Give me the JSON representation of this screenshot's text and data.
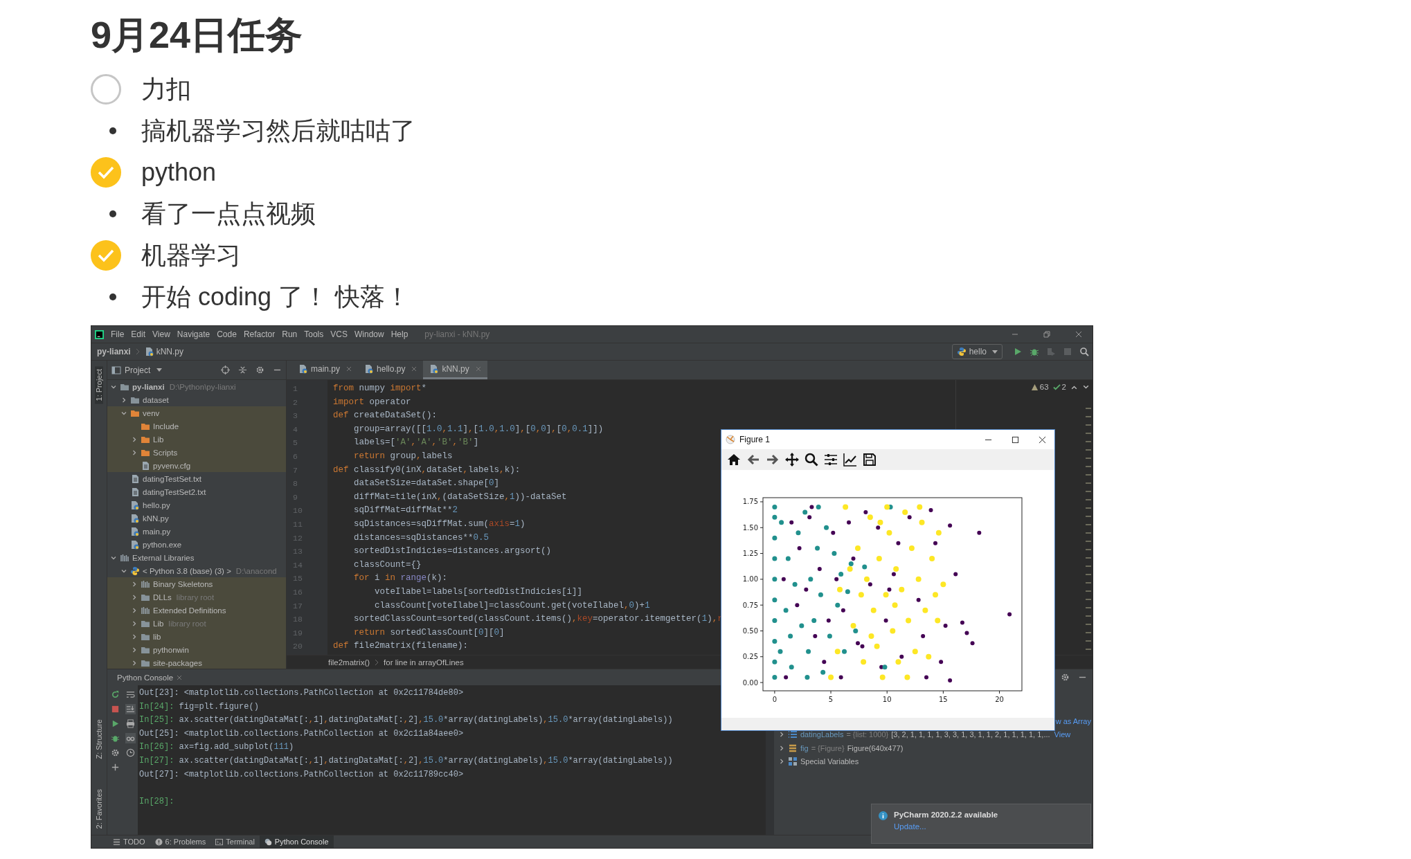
{
  "page_title": "9月24日任务",
  "tasks": [
    {
      "kind": "todo",
      "text": "力扣",
      "checked": false
    },
    {
      "kind": "bullet",
      "text": "搞机器学习然后就咕咕了"
    },
    {
      "kind": "todo",
      "text": "python",
      "checked": true
    },
    {
      "kind": "bullet",
      "text": "看了一点点视频"
    },
    {
      "kind": "todo",
      "text": "机器学习",
      "checked": true
    },
    {
      "kind": "bullet",
      "text": "开始 coding 了！ 快落！"
    }
  ],
  "ide": {
    "menu": [
      "File",
      "Edit",
      "View",
      "Navigate",
      "Code",
      "Refactor",
      "Run",
      "Tools",
      "VCS",
      "Window",
      "Help"
    ],
    "window_title": "py-lianxi - kNN.py",
    "breadcrumb": [
      "py-lianxi",
      "kNN.py"
    ],
    "run_config": "hello",
    "side_labels": [
      {
        "label": "1: Project",
        "selected": true
      },
      {
        "label": "Z: Structure",
        "selected": false
      },
      {
        "label": "2: Favorites",
        "selected": false
      }
    ],
    "project_panel": {
      "title": "Project",
      "tree": [
        {
          "label": "py-lianxi",
          "kind": "project",
          "hint": "D:\\Python\\py-lianxi",
          "expanded": true,
          "highlighted": false,
          "children": [
            {
              "label": "dataset",
              "kind": "folder",
              "expanded": false,
              "highlighted": false
            },
            {
              "label": "venv",
              "kind": "excluded-folder",
              "expanded": true,
              "highlighted": true,
              "children": [
                {
                  "label": "Include",
                  "kind": "excluded-folder",
                  "highlighted": true
                },
                {
                  "label": "Lib",
                  "kind": "excluded-folder",
                  "expanded": false,
                  "highlighted": true
                },
                {
                  "label": "Scripts",
                  "kind": "excluded-folder",
                  "expanded": false,
                  "highlighted": true
                },
                {
                  "label": "pyvenv.cfg",
                  "kind": "text-file",
                  "highlighted": true
                }
              ]
            },
            {
              "label": "datingTestSet.txt",
              "kind": "text-file",
              "highlighted": false
            },
            {
              "label": "datingTestSet2.txt",
              "kind": "text-file",
              "highlighted": false
            },
            {
              "label": "hello.py",
              "kind": "py-file",
              "highlighted": false
            },
            {
              "label": "kNN.py",
              "kind": "py-file",
              "highlighted": false
            },
            {
              "label": "main.py",
              "kind": "py-file",
              "highlighted": false
            },
            {
              "label": "python.exe",
              "kind": "exe-file",
              "highlighted": false
            }
          ]
        },
        {
          "label": "External Libraries",
          "kind": "library",
          "expanded": true,
          "highlighted": false,
          "children": [
            {
              "label": "< Python 3.8 (base) (3) >",
              "kind": "python-sdk",
              "hint": "D:\\anacond",
              "expanded": true,
              "highlighted": false,
              "children": [
                {
                  "label": "Binary Skeletons",
                  "kind": "library",
                  "expanded": false,
                  "highlighted": true
                },
                {
                  "label": "DLLs",
                  "kind": "folder",
                  "hint": "library root",
                  "expanded": false,
                  "highlighted": true
                },
                {
                  "label": "Extended Definitions",
                  "kind": "library",
                  "expanded": false,
                  "highlighted": true
                },
                {
                  "label": "Lib",
                  "kind": "folder",
                  "hint": "library root",
                  "expanded": false,
                  "highlighted": true
                },
                {
                  "label": "lib",
                  "kind": "folder",
                  "expanded": false,
                  "highlighted": true
                },
                {
                  "label": "pythonwin",
                  "kind": "folder",
                  "expanded": false,
                  "highlighted": true
                },
                {
                  "label": "site-packages",
                  "kind": "folder",
                  "expanded": false,
                  "highlighted": true
                }
              ]
            }
          ]
        }
      ]
    },
    "editor_tabs": [
      {
        "label": "main.py",
        "selected": false
      },
      {
        "label": "hello.py",
        "selected": false
      },
      {
        "label": "kNN.py",
        "selected": true
      }
    ],
    "inspections": {
      "warnings": "63",
      "typos": "2"
    },
    "code_lines": [
      {
        "n": "1",
        "t": [
          {
            "kind": "kw",
            "text": "from"
          },
          {
            "kind": "tx",
            "text": " numpy "
          },
          {
            "kind": "kw",
            "text": "import"
          },
          {
            "kind": "tx",
            "text": "*"
          }
        ]
      },
      {
        "n": "2",
        "t": [
          {
            "kind": "kw",
            "text": "import"
          },
          {
            "kind": "tx",
            "text": " operator"
          }
        ]
      },
      {
        "n": "3",
        "t": [
          {
            "kind": "kw",
            "text": "def"
          },
          {
            "kind": "tx",
            "text": " createDataSet():"
          }
        ]
      },
      {
        "n": "4",
        "t": [
          {
            "kind": "tx",
            "text": "    group=array([["
          },
          {
            "kind": "num",
            "text": "1.0"
          },
          {
            "kind": "tx",
            "text": ","
          },
          {
            "kind": "num",
            "text": "1.1"
          },
          {
            "kind": "tx",
            "text": "],["
          },
          {
            "kind": "num",
            "text": "1.0"
          },
          {
            "kind": "tx",
            "text": ","
          },
          {
            "kind": "num",
            "text": "1.0"
          },
          {
            "kind": "tx",
            "text": "],["
          },
          {
            "kind": "num",
            "text": "0"
          },
          {
            "kind": "tx",
            "text": ","
          },
          {
            "kind": "num",
            "text": "0"
          },
          {
            "kind": "tx",
            "text": "],["
          },
          {
            "kind": "num",
            "text": "0"
          },
          {
            "kind": "tx",
            "text": ","
          },
          {
            "kind": "num",
            "text": "0.1"
          },
          {
            "kind": "tx",
            "text": "]])"
          }
        ]
      },
      {
        "n": "5",
        "t": [
          {
            "kind": "tx",
            "text": "    labels=["
          },
          {
            "kind": "str",
            "text": "'A'"
          },
          {
            "kind": "tx",
            "text": ","
          },
          {
            "kind": "str",
            "text": "'A'"
          },
          {
            "kind": "tx",
            "text": ","
          },
          {
            "kind": "str",
            "text": "'B'"
          },
          {
            "kind": "tx",
            "text": ","
          },
          {
            "kind": "str",
            "text": "'B'"
          },
          {
            "kind": "tx",
            "text": "]"
          }
        ]
      },
      {
        "n": "6",
        "t": [
          {
            "kind": "kw",
            "text": "    return"
          },
          {
            "kind": "tx",
            "text": " group,labels"
          }
        ]
      },
      {
        "n": "7",
        "t": [
          {
            "kind": "kw",
            "text": "def"
          },
          {
            "kind": "tx",
            "text": " classify0(inX,dataSet,labels,k):"
          }
        ]
      },
      {
        "n": "8",
        "t": [
          {
            "kind": "tx",
            "text": "    dataSetSize=dataSet.shape["
          },
          {
            "kind": "num",
            "text": "0"
          },
          {
            "kind": "tx",
            "text": "]"
          }
        ]
      },
      {
        "n": "9",
        "t": [
          {
            "kind": "tx",
            "text": "    diffMat=tile(inX,(dataSetSize,"
          },
          {
            "kind": "num",
            "text": "1"
          },
          {
            "kind": "tx",
            "text": "))-dataSet"
          }
        ]
      },
      {
        "n": "10",
        "t": [
          {
            "kind": "tx",
            "text": "    sqDiffMat=diffMat**"
          },
          {
            "kind": "num",
            "text": "2"
          }
        ]
      },
      {
        "n": "11",
        "t": [
          {
            "kind": "tx",
            "text": "    sqDistances=sqDiffMat.sum("
          },
          {
            "kind": "arg",
            "text": "axis"
          },
          {
            "kind": "tx",
            "text": "="
          },
          {
            "kind": "num",
            "text": "1"
          },
          {
            "kind": "tx",
            "text": ")"
          }
        ]
      },
      {
        "n": "12",
        "t": [
          {
            "kind": "tx",
            "text": "    distances=sqDistances**"
          },
          {
            "kind": "num",
            "text": "0.5"
          }
        ]
      },
      {
        "n": "13",
        "t": [
          {
            "kind": "tx",
            "text": "    sortedDistIndicies=distances.argsort()"
          }
        ]
      },
      {
        "n": "14",
        "t": [
          {
            "kind": "tx",
            "text": "    classCount={}"
          }
        ]
      },
      {
        "n": "15",
        "t": [
          {
            "kind": "kw",
            "text": "    for"
          },
          {
            "kind": "tx",
            "text": " i "
          },
          {
            "kind": "kw",
            "text": "in"
          },
          {
            "kind": "bi",
            "text": " range"
          },
          {
            "kind": "tx",
            "text": "(k):"
          }
        ]
      },
      {
        "n": "16",
        "t": [
          {
            "kind": "tx",
            "text": "        voteIlabel=labels[sortedDistIndicies[i]]"
          }
        ]
      },
      {
        "n": "17",
        "t": [
          {
            "kind": "tx",
            "text": "        classCount[voteIlabel]=classCount.get(voteIlabel,"
          },
          {
            "kind": "num",
            "text": "0"
          },
          {
            "kind": "tx",
            "text": ")+"
          },
          {
            "kind": "num",
            "text": "1"
          }
        ]
      },
      {
        "n": "18",
        "t": [
          {
            "kind": "tx",
            "text": "    sortedClassCount=sorted(classCount.items(),"
          },
          {
            "kind": "arg",
            "text": "key"
          },
          {
            "kind": "tx",
            "text": "=operator.itemgetter("
          },
          {
            "kind": "num",
            "text": "1"
          },
          {
            "kind": "tx",
            "text": "),"
          },
          {
            "kind": "arg",
            "text": "r"
          }
        ]
      },
      {
        "n": "19",
        "t": [
          {
            "kind": "kw",
            "text": "    return"
          },
          {
            "kind": "tx",
            "text": " sortedClassCount["
          },
          {
            "kind": "num",
            "text": "0"
          },
          {
            "kind": "tx",
            "text": "]["
          },
          {
            "kind": "num",
            "text": "0"
          },
          {
            "kind": "tx",
            "text": "]"
          }
        ]
      },
      {
        "n": "20",
        "t": [
          {
            "kind": "kw",
            "text": "def"
          },
          {
            "kind": "tx",
            "text": " file2matrix(filename):"
          }
        ]
      }
    ],
    "code_breadcrumb": [
      "file2matrix()",
      "for line in arrayOfLines"
    ],
    "console": {
      "title": "Python Console",
      "lines": [
        {
          "kind": "out",
          "text": "Out[23]: <matplotlib.collections.PathCollection at 0x2c11784de80>"
        },
        {
          "kind": "in",
          "prompt": "In[24]:",
          "t": [
            {
              "kind": "tx",
              "text": " fig=plt.figure()"
            }
          ]
        },
        {
          "kind": "in",
          "prompt": "In[25]:",
          "t": [
            {
              "kind": "tx",
              "text": " ax.scatter(datingDataMat[:,1],datingDataMat[:,2],"
            },
            {
              "kind": "num",
              "text": "15.0"
            },
            {
              "kind": "tx",
              "text": "*array(datingLabels),"
            },
            {
              "kind": "num",
              "text": "15.0"
            },
            {
              "kind": "tx",
              "text": "*array(datingLabels))"
            }
          ]
        },
        {
          "kind": "out",
          "text": "Out[25]: <matplotlib.collections.PathCollection at 0x2c11a84aee0>"
        },
        {
          "kind": "in",
          "prompt": "In[26]:",
          "t": [
            {
              "kind": "tx",
              "text": " ax=fig.add_subplot("
            },
            {
              "kind": "num",
              "text": "111"
            },
            {
              "kind": "tx",
              "text": ")"
            }
          ]
        },
        {
          "kind": "in",
          "prompt": "In[27]:",
          "t": [
            {
              "kind": "tx",
              "text": " ax.scatter(datingDataMat[:,1],datingDataMat[:,2],"
            },
            {
              "kind": "num",
              "text": "15.0"
            },
            {
              "kind": "tx",
              "text": "*array(datingLabels),"
            },
            {
              "kind": "num",
              "text": "15.0"
            },
            {
              "kind": "tx",
              "text": "*array(datingLabels))"
            }
          ]
        },
        {
          "kind": "out",
          "text": "Out[27]: <matplotlib.collections.PathCollection at 0x2c11789cc40>"
        },
        {
          "kind": "blank"
        },
        {
          "kind": "in",
          "prompt": "In[28]:"
        }
      ]
    },
    "variables": {
      "covered_link": "w as Array",
      "rows": [
        {
          "kind": "list",
          "name": "datingLabels",
          "type": "= {list: 1000}",
          "value": "[3, 2, 1, 1, 1, 1, 3, 3, 1, 3, 1, 1, 2, 1, 1, 1, 1, 1,...",
          "link": "View"
        },
        {
          "kind": "object",
          "name": "fig",
          "type": "= {Figure}",
          "value": "Figure(640x477)"
        },
        {
          "kind": "special",
          "name": "Special Variables"
        }
      ]
    },
    "notification": {
      "title": "PyCharm 2020.2.2 available",
      "link": "Update..."
    },
    "tool_tabs": [
      {
        "label": "TODO",
        "kind": "todo",
        "selected": false
      },
      {
        "label": "6: Problems",
        "kind": "problems",
        "selected": false
      },
      {
        "label": "Terminal",
        "kind": "terminal",
        "selected": false
      },
      {
        "label": "Python Console",
        "kind": "python",
        "selected": true
      }
    ],
    "figure": {
      "title": "Figure 1",
      "chart_data": {
        "type": "scatter",
        "xlim": [
          -1.04,
          22
        ],
        "ylim": [
          -0.08,
          1.79
        ],
        "xticks": [
          0,
          5,
          10,
          15,
          20
        ],
        "yticks": [
          {
            "value": 0,
            "label": "0.00"
          },
          {
            "value": 0.25,
            "label": "0.25"
          },
          {
            "value": 0.5,
            "label": "0.50"
          },
          {
            "value": 0.75,
            "label": "0.75"
          },
          {
            "value": 1,
            "label": "1.00"
          },
          {
            "value": 1.25,
            "label": "1.25"
          },
          {
            "value": 1.5,
            "label": "1.50"
          },
          {
            "value": 1.75,
            "label": "1.75"
          }
        ],
        "series": [
          {
            "color": "#440154",
            "x": [
              1.5,
              2.2,
              3.1,
              4.0,
              2.8,
              3.6,
              4.4,
              5.2,
              6.1,
              7.0,
              7.8,
              8.5,
              9.2,
              9.9,
              10.6,
              11.3,
              12.0,
              12.8,
              13.5,
              13.9,
              14.3,
              15.2,
              15.6,
              16.1,
              16.7,
              17.1,
              17.6,
              18.2,
              20.9,
              1.0,
              2.0,
              3.3,
              4.8,
              5.9,
              6.6,
              8.1,
              9.5,
              11.0,
              13.2,
              14.8,
              15.6,
              0.8,
              5.5,
              7.4,
              10.2
            ],
            "values": [
              1.55,
              1.3,
              1.6,
              1.1,
              0.9,
              0.45,
              0.2,
              1.45,
              0.7,
              1.2,
              0.35,
              0.95,
              1.5,
              0.6,
              1.05,
              0.25,
              1.6,
              0.8,
              0.05,
              1.67,
              1.35,
              0.55,
              1.52,
              1.05,
              0.58,
              0.48,
              0.38,
              1.45,
              0.66,
              0.05,
              0.75,
              1.7,
              0.6,
              0.05,
              1.55,
              1.65,
              0.15,
              1.35,
              0.45,
              0.2,
              0.02,
              1.0,
              1.0,
              0.38,
              0.9
            ]
          },
          {
            "color": "#21908d",
            "x": [
              0,
              0,
              0,
              0,
              0,
              0,
              0,
              0,
              0,
              0,
              0.5,
              0.6,
              1.0,
              1.2,
              1.5,
              1.8,
              2.1,
              2.4,
              2.7,
              3.0,
              3.2,
              3.5,
              3.8,
              4.1,
              4.3,
              4.6,
              4.9,
              5.3,
              5.6,
              5.9,
              6.2,
              6.5,
              6.8,
              7.2,
              8.0,
              9.8,
              10.3,
              2.9,
              3.9,
              1.4
            ],
            "values": [
              0.05,
              0.2,
              0.4,
              0.6,
              0.8,
              1.0,
              1.2,
              1.4,
              1.6,
              1.7,
              0.3,
              1.55,
              0.7,
              1.2,
              0.15,
              0.95,
              1.45,
              0.55,
              1.65,
              0.3,
              1.0,
              0.6,
              1.3,
              0.85,
              0.1,
              1.5,
              0.45,
              1.25,
              0.75,
              1.05,
              0.3,
              0.88,
              1.15,
              0.5,
              1.12,
              0.15,
              1.7,
              0.05,
              1.7,
              0.45
            ]
          },
          {
            "color": "#fde725",
            "x": [
              5.0,
              5.8,
              6.3,
              7.0,
              7.4,
              7.9,
              8.2,
              8.5,
              8.8,
              9.1,
              9.3,
              9.6,
              9.9,
              10.2,
              10.5,
              10.8,
              11.0,
              11.3,
              11.6,
              11.9,
              12.2,
              12.5,
              12.8,
              13.1,
              13.4,
              13.7,
              14.0,
              14.3,
              14.6,
              15.0,
              7.7,
              8.6,
              10.0,
              11.8,
              12.9,
              6.7,
              9.4,
              10.7,
              5.6,
              14.5
            ],
            "values": [
              0.05,
              0.9,
              1.7,
              0.55,
              1.3,
              0.2,
              1.0,
              1.6,
              0.7,
              0.35,
              1.2,
              0.05,
              0.85,
              1.45,
              0.5,
              1.1,
              0.2,
              0.9,
              1.65,
              0.6,
              1.3,
              0.3,
              1.0,
              1.55,
              0.7,
              0.25,
              1.2,
              0.85,
              1.45,
              0.95,
              0.85,
              0.45,
              1.7,
              0.05,
              1.7,
              1.1,
              1.55,
              0.75,
              0.3,
              0.6
            ]
          }
        ]
      }
    }
  }
}
